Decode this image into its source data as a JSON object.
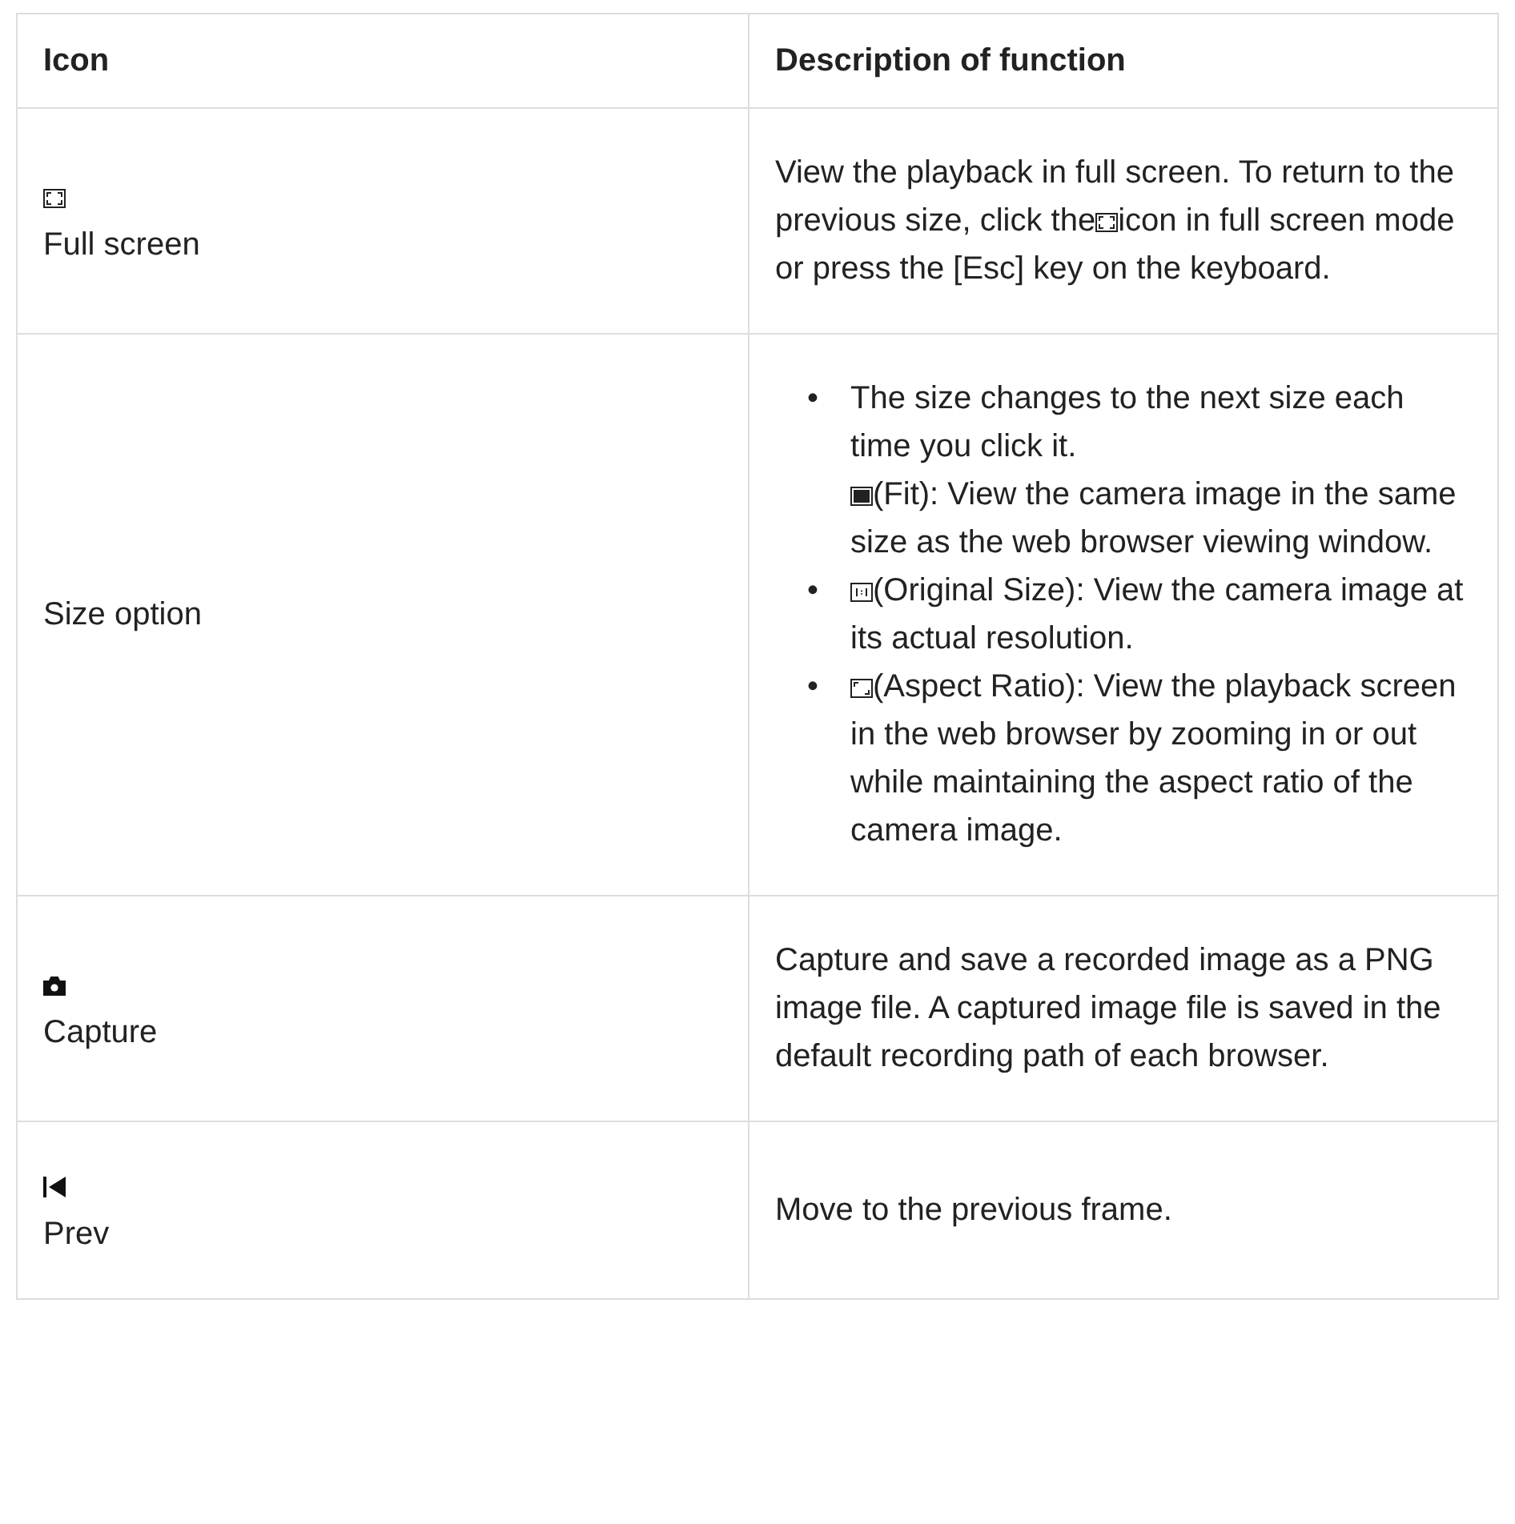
{
  "table": {
    "columns": [
      "Icon",
      "Description of function"
    ],
    "rows": [
      {
        "kind": "fullscreen",
        "name": "Full screen",
        "description": [
          {
            "kind": "paragraph",
            "parts": [
              {
                "kind": "text",
                "text": "View the playback in full screen. To return to the previous size, click the"
              },
              {
                "kind": "fullscreen"
              },
              {
                "kind": "text",
                "text": "icon in full screen mode or press the [Esc] key on the keyboard."
              }
            ]
          }
        ]
      },
      {
        "kind": "plain",
        "name": "Size option",
        "description": [
          {
            "kind": "bullets",
            "items": [
              {
                "marker": "•",
                "lines": [
                  [
                    {
                      "kind": "text",
                      "text": "The size changes to the next size each time you click it."
                    }
                  ],
                  [
                    {
                      "kind": "fit"
                    },
                    {
                      "kind": "text",
                      "text": "(Fit): View the camera image in the same size as the web browser viewing window."
                    }
                  ]
                ]
              },
              {
                "marker": "•",
                "lines": [
                  [
                    {
                      "kind": "original"
                    },
                    {
                      "kind": "text",
                      "text": "(Original Size): View the camera image at its actual resolution."
                    }
                  ]
                ]
              },
              {
                "marker": "•",
                "lines": [
                  [
                    {
                      "kind": "aspect"
                    },
                    {
                      "kind": "text",
                      "text": "(Aspect Ratio): View the playback screen in the web browser by zooming in or out while maintaining the aspect ratio of the camera image."
                    }
                  ]
                ]
              }
            ]
          }
        ]
      },
      {
        "kind": "capture",
        "name": "Capture",
        "description": [
          {
            "kind": "paragraph",
            "parts": [
              {
                "kind": "text",
                "text": "Capture and save a recorded image as a PNG image file. A captured image file is saved in the default recording path of each browser."
              }
            ]
          }
        ]
      },
      {
        "kind": "prev",
        "name": "Prev",
        "description": [
          {
            "kind": "paragraph",
            "parts": [
              {
                "kind": "text",
                "text": "Move to the previous frame."
              }
            ]
          }
        ]
      }
    ]
  }
}
